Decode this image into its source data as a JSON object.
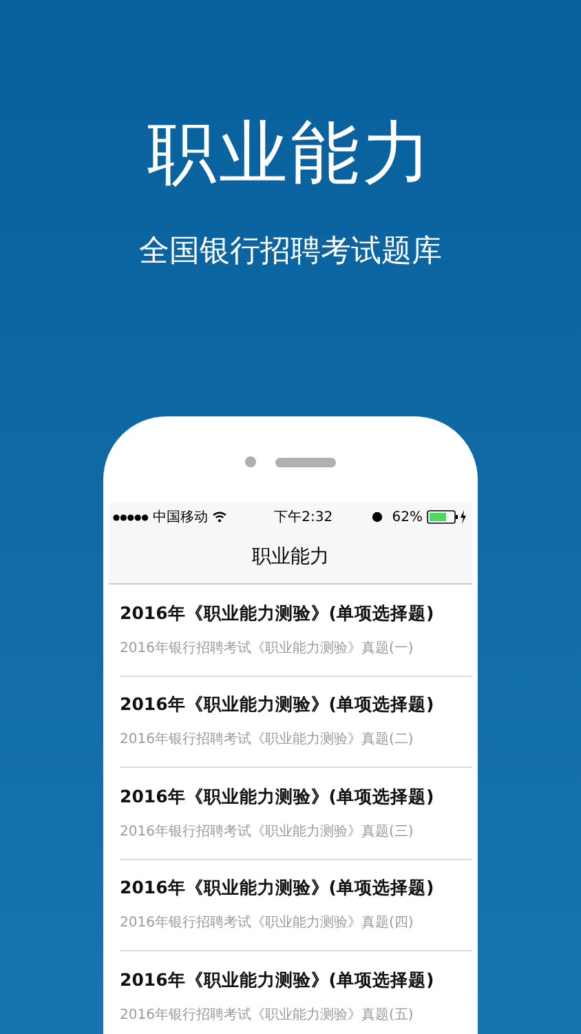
{
  "headline": "职业能力",
  "tagline": "全国银行招聘考试题库",
  "status_bar": {
    "carrier": "中国移动",
    "time": "下午2:32",
    "battery": "62%"
  },
  "nav_bar": {
    "title": "职业能力"
  },
  "items": [
    {
      "title": "2016年《职业能力测验》(单项选择题)",
      "subtitle": "2016年银行招聘考试《职业能力测验》真题(一)"
    },
    {
      "title": "2016年《职业能力测验》(单项选择题)",
      "subtitle": "2016年银行招聘考试《职业能力测验》真题(二)"
    },
    {
      "title": "2016年《职业能力测验》(单项选择题)",
      "subtitle": "2016年银行招聘考试《职业能力测验》真题(三)"
    },
    {
      "title": "2016年《职业能力测验》(单项选择题)",
      "subtitle": "2016年银行招聘考试《职业能力测验》真题(四)"
    },
    {
      "title": "2016年《职业能力测验》(单项选择题)",
      "subtitle": "2016年银行招聘考试《职业能力测验》真题(五)"
    }
  ]
}
